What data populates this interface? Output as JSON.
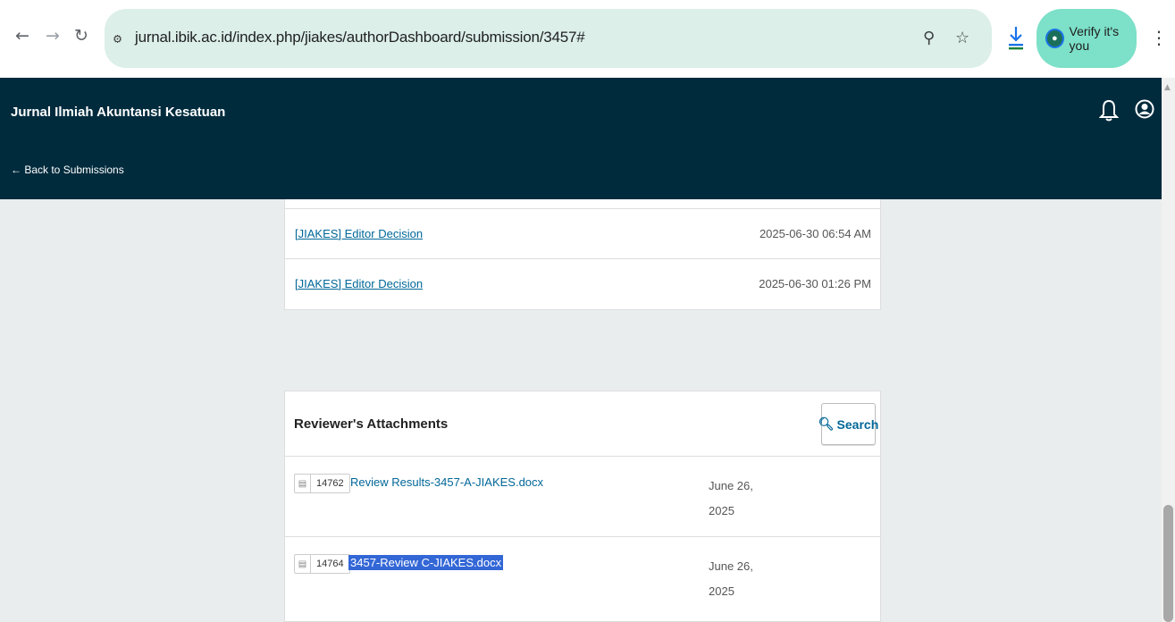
{
  "browser": {
    "url": "jurnal.ibik.ac.id/index.php/jiakes/authorDashboard/submission/3457#",
    "verify_label": "Verify it's you"
  },
  "header": {
    "journal_title": "Jurnal Ilmiah Akuntansi Kesatuan",
    "back_link": "← Back to Submissions"
  },
  "emails": [
    {
      "subject": "[JIAKES] Editor Decision",
      "date": "2025-06-30 06:54 AM"
    },
    {
      "subject": "[JIAKES] Editor Decision",
      "date": "2025-06-30 01:26 PM"
    }
  ],
  "attachments": {
    "title": "Reviewer's Attachments",
    "search_label": "Search",
    "files": [
      {
        "id": "14762",
        "name": "Review Results-3457-A-JIAKES.docx",
        "date_line1": "June 26,",
        "date_line2": "2025"
      },
      {
        "id": "14764",
        "name": "3457-Review C-JIAKES.docx",
        "date_line1": "June 26,",
        "date_line2": "2025"
      }
    ]
  },
  "colors": {
    "header_bg": "#002b3d",
    "link": "#006798",
    "selection": "#3367d6",
    "omnibox_bg": "#dcefe8",
    "verify_bg": "#7de0c8"
  }
}
